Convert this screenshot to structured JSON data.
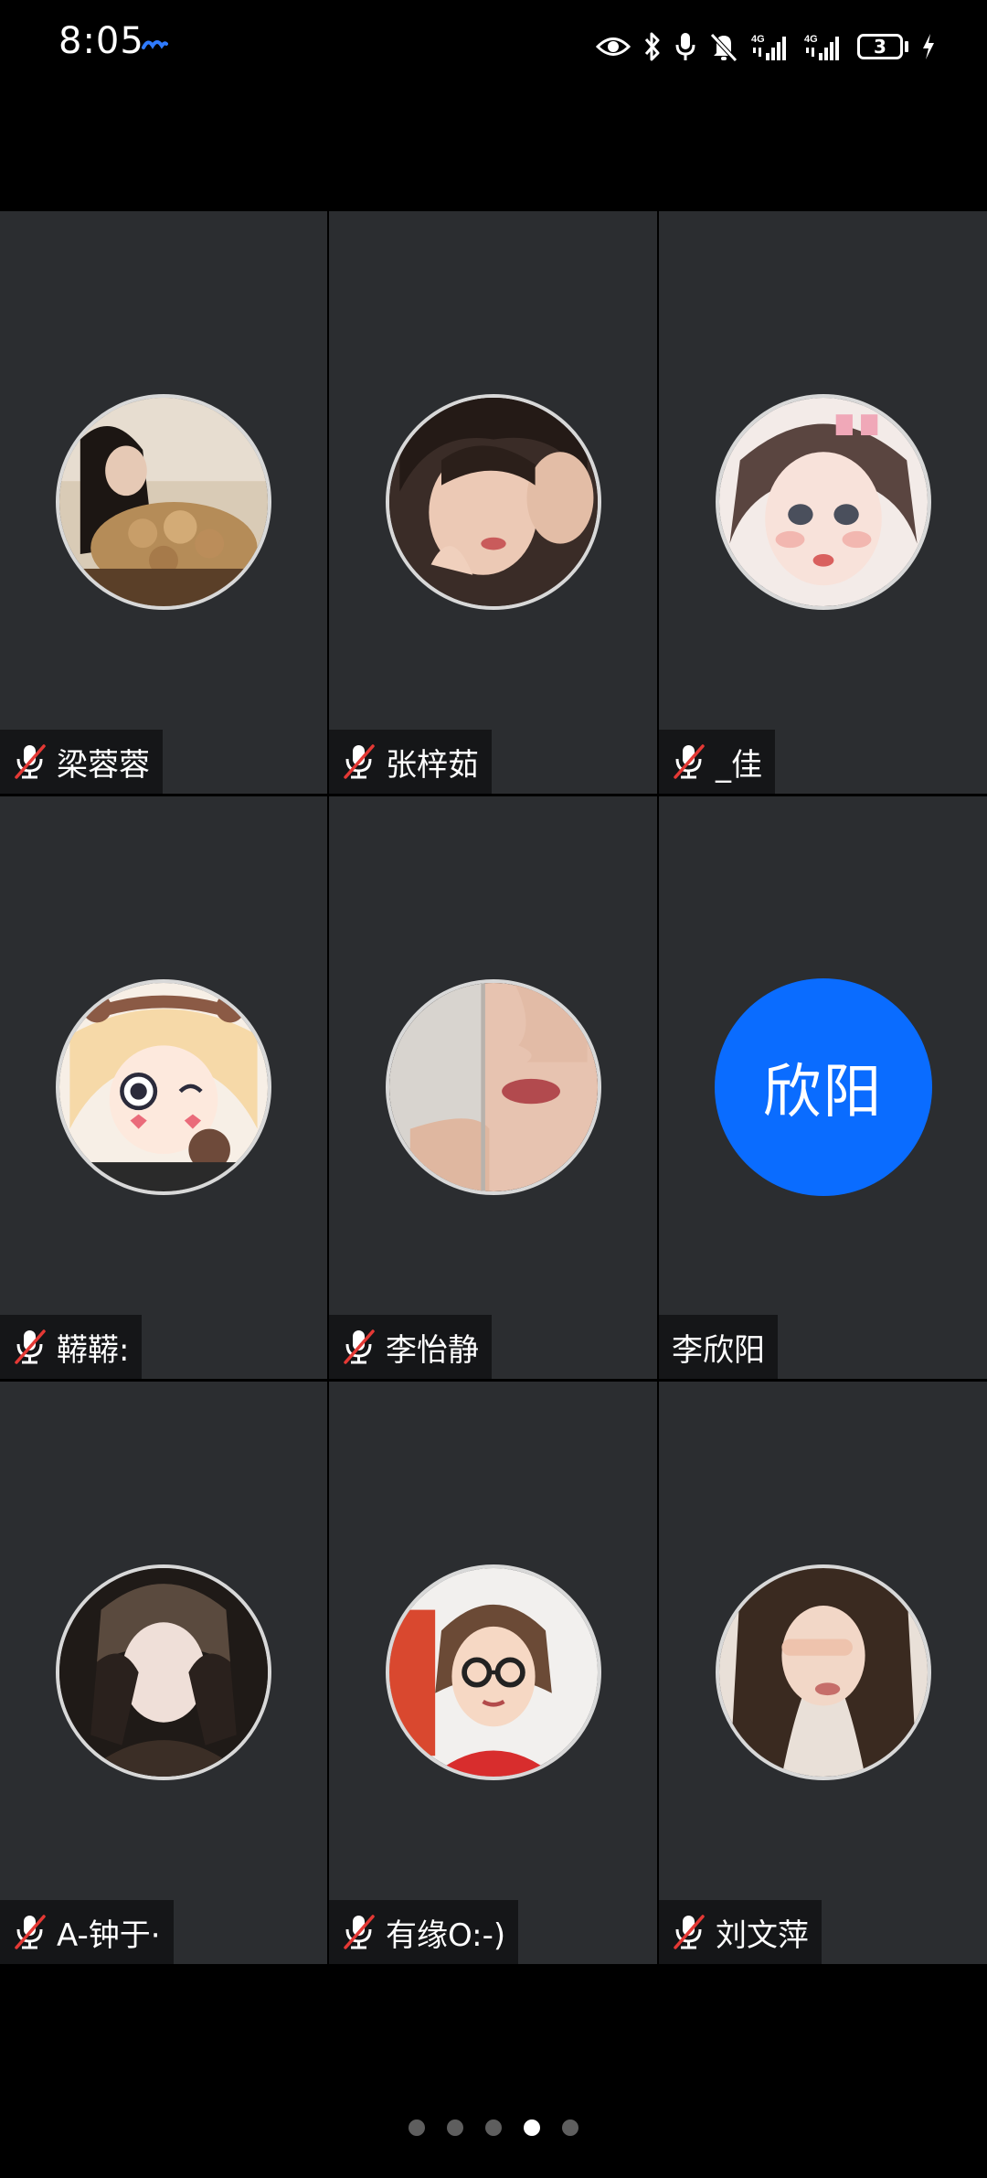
{
  "status_bar": {
    "time": "8:05",
    "battery_level": "3",
    "network_1": "4G",
    "network_2": "4G",
    "icons": [
      "eye-icon",
      "bluetooth-icon",
      "microphone-icon",
      "bell-muted-icon",
      "signal-icon",
      "signal-icon",
      "battery-icon",
      "charging-icon"
    ]
  },
  "participants": [
    {
      "name": "梁蓉蓉",
      "muted": true,
      "avatar": "photo"
    },
    {
      "name": "张梓茹",
      "muted": true,
      "avatar": "photo"
    },
    {
      "name": "_佳",
      "muted": true,
      "avatar": "photo"
    },
    {
      "name": "鞯鞯:",
      "muted": true,
      "avatar": "photo"
    },
    {
      "name": "李怡静",
      "muted": true,
      "avatar": "photo"
    },
    {
      "name": "李欣阳",
      "muted": false,
      "avatar": "initials",
      "initials": "欣阳"
    },
    {
      "name": "A-钟于·",
      "muted": true,
      "avatar": "photo"
    },
    {
      "name": "有缘O:-)",
      "muted": true,
      "avatar": "photo"
    },
    {
      "name": "刘文萍",
      "muted": true,
      "avatar": "photo"
    }
  ],
  "pagination": {
    "total_pages": 5,
    "current_page": 4
  },
  "colors": {
    "tile_bg": "#2b2d30",
    "initials_bg": "#0a6cff",
    "mute_red": "#e53935",
    "dot_inactive": "#5e5e5e",
    "dot_active": "#ffffff"
  }
}
